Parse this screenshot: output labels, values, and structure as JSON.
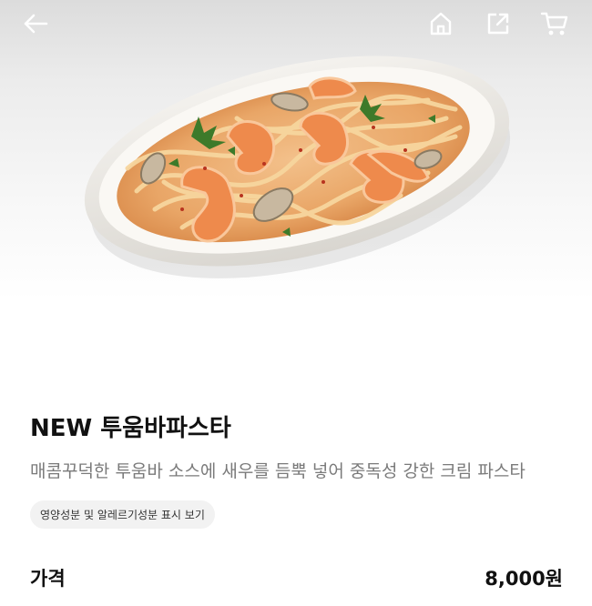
{
  "header": {
    "back_icon": "back-arrow-icon",
    "home_icon": "home-icon",
    "share_icon": "share-icon",
    "cart_icon": "cart-icon"
  },
  "product": {
    "image": "creamy-shrimp-pasta-plate",
    "title": "NEW 투움바파스타",
    "description": "매콤꾸덕한 투움바 소스에 새우를 듬뿍 넣어 중독성 강한 크림 파스타",
    "nutrition_label": "영양성분 및 알레르기성분 표시 보기"
  },
  "price": {
    "label": "가격",
    "value": "8,000원"
  }
}
